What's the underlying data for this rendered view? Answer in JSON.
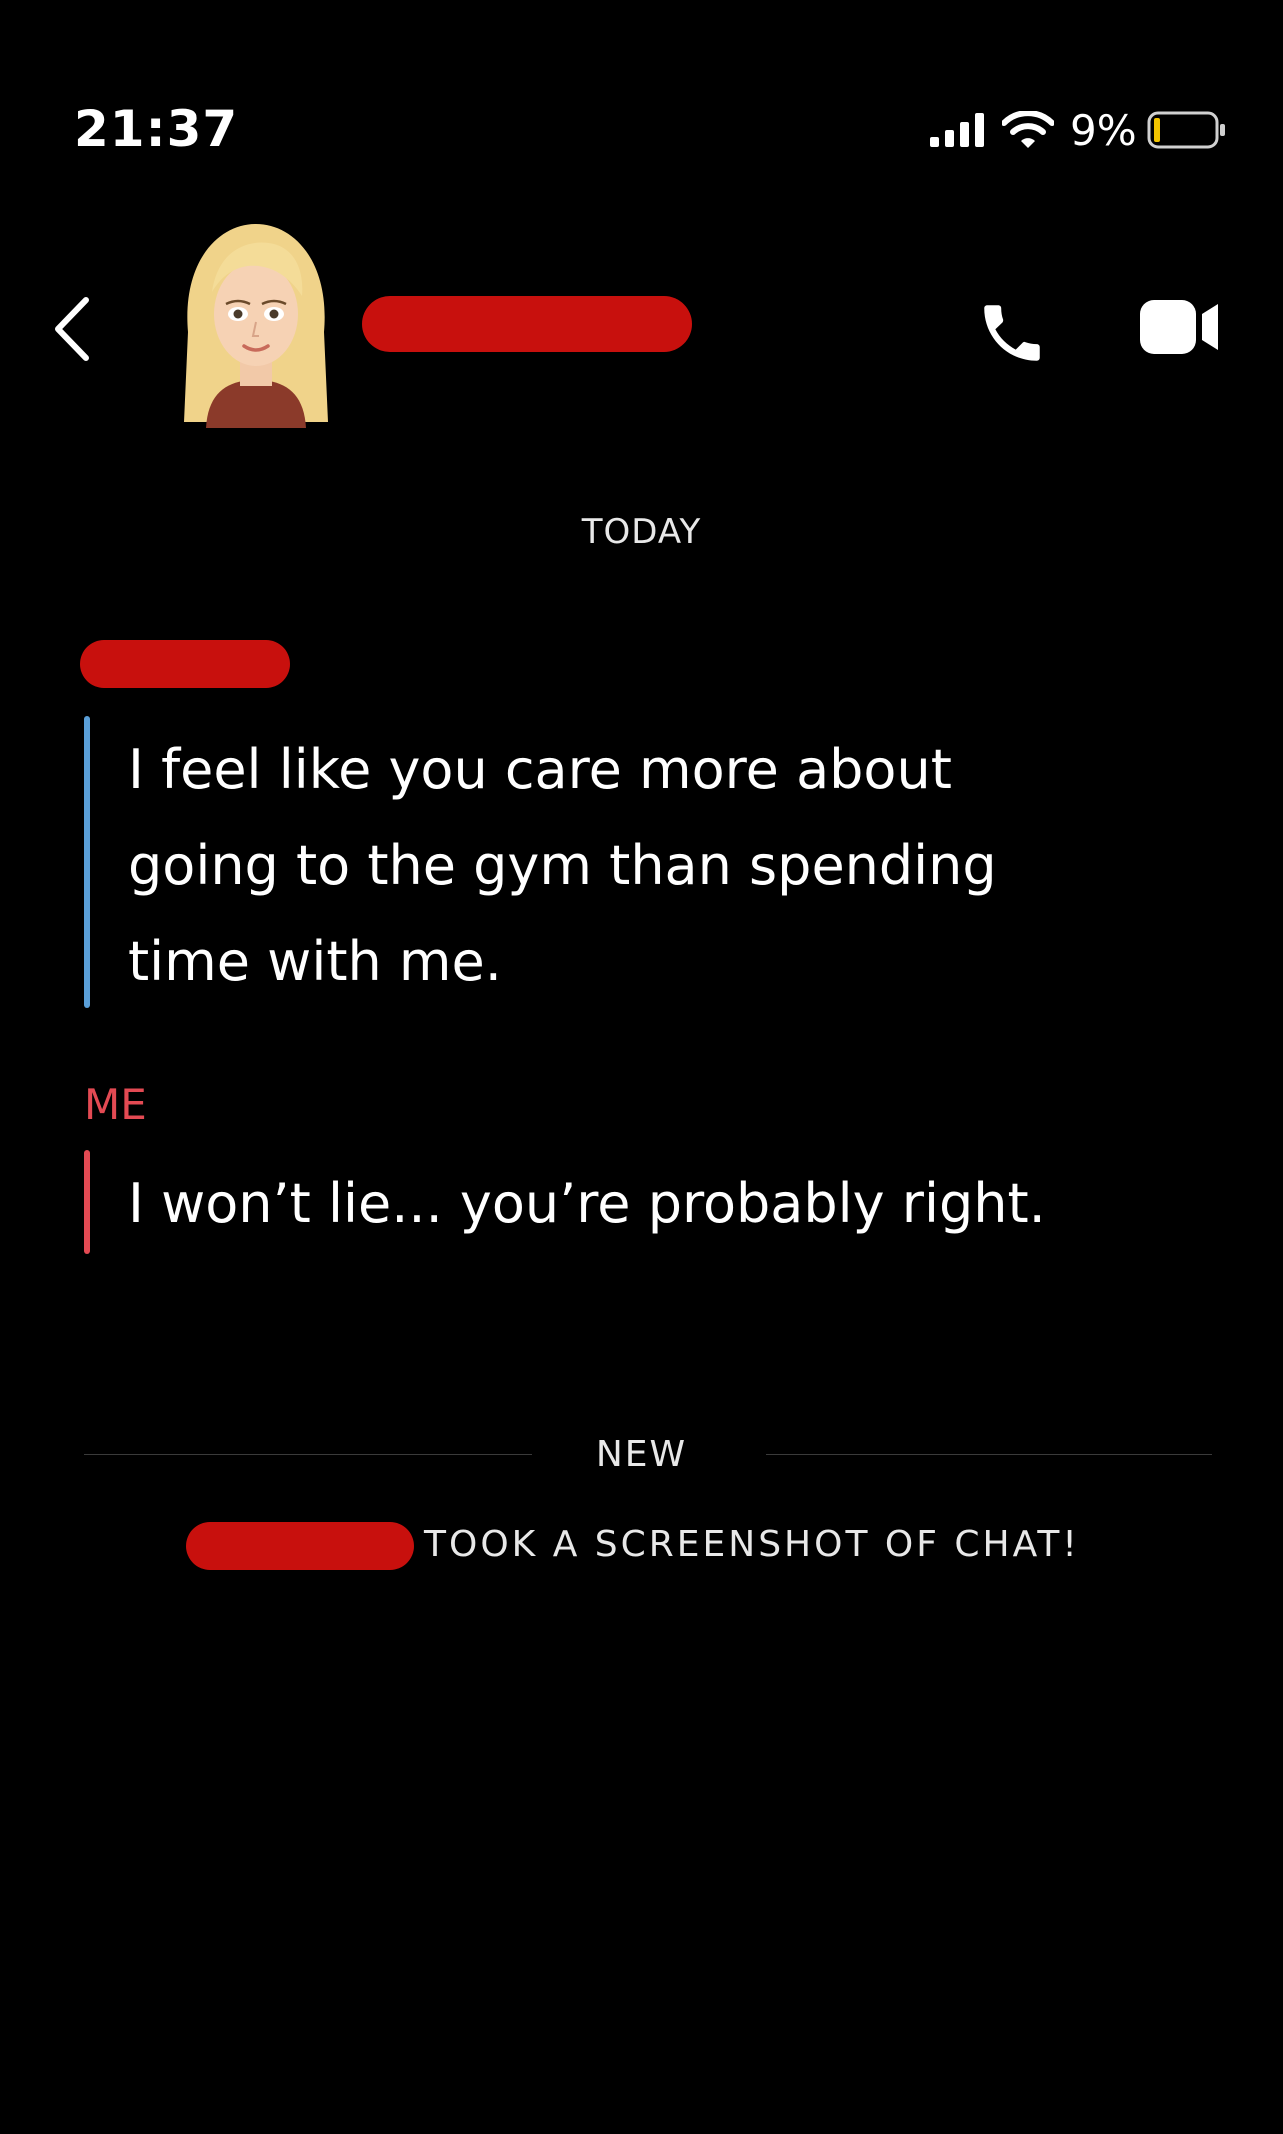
{
  "status_bar": {
    "time": "21:37",
    "battery_percent": "9%",
    "icons": [
      "signal-icon",
      "wifi-icon",
      "battery-icon"
    ]
  },
  "header": {
    "icons": [
      "back-icon",
      "avatar",
      "phone-call-icon",
      "video-call-icon"
    ]
  },
  "chat": {
    "day_label": "TODAY",
    "messages": [
      {
        "text": "I feel like you care more about going to the gym than spending time with me.",
        "bar_color": "#5a9fd8"
      },
      {
        "sender": "ME",
        "text": "I won’t lie... you’re probably right.",
        "bar_color": "#e34a53"
      }
    ],
    "new_label": "NEW",
    "screenshot_notice": "TOOK A SCREENSHOT OF CHAT!"
  },
  "colors": {
    "background": "#000000",
    "me_accent": "#e34a53",
    "friend_accent": "#5a9fd8",
    "redaction": "#c8100d"
  }
}
